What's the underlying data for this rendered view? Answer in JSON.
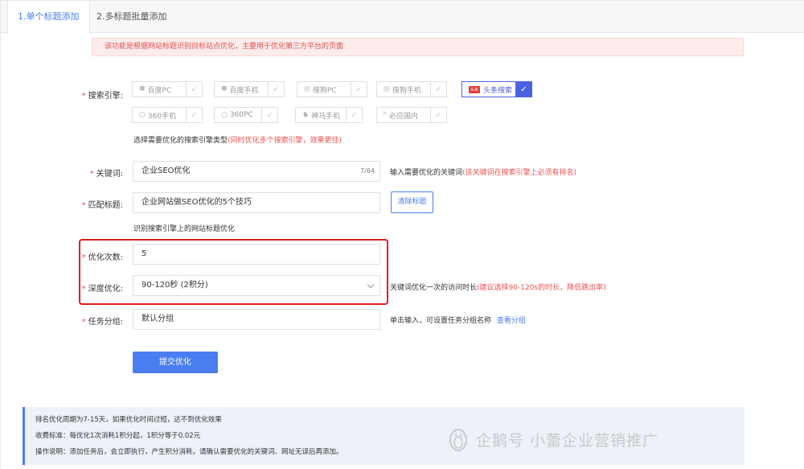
{
  "tabs": [
    {
      "label": "1.单个标题添加",
      "active": true
    },
    {
      "label": "2.多标题批量添加",
      "active": false
    }
  ],
  "notice": "该功能是根据网站标题识别目标站点优化，主要用于优化第三方平台的页面",
  "engines": {
    "label": "搜索引擎:",
    "row1": [
      {
        "name": "百度PC",
        "icon": "baidu-icon",
        "selected": false
      },
      {
        "name": "百度手机",
        "icon": "baidu-icon",
        "selected": false
      },
      {
        "name": "搜狗PC",
        "icon": "sogou-icon",
        "selected": false
      },
      {
        "name": "搜狗手机",
        "icon": "sogou-icon",
        "selected": false
      },
      {
        "name": "头条搜索",
        "icon": "toutiao-icon",
        "selected": true
      }
    ],
    "row2": [
      {
        "name": "360手机",
        "icon": "360-icon",
        "selected": false
      },
      {
        "name": "360PC",
        "icon": "360-icon",
        "selected": false
      },
      {
        "name": "神马手机",
        "icon": "shenma-icon",
        "selected": false
      },
      {
        "name": "必应国内",
        "icon": "bing-icon",
        "selected": false
      }
    ],
    "toutiao_badge": "头条",
    "hint": "选择需要优化的搜索引擎类型",
    "hint_red": "(同时优化多个搜索引擎，效果更佳)"
  },
  "keyword": {
    "label": "关键词:",
    "value": "企业SEO优化",
    "count": "7/64",
    "hint": "输入需要优化的关键词",
    "hint_red": "(该关键词在搜索引擎上必须有排名)"
  },
  "title": {
    "label": "匹配标题:",
    "value": "企业网站做SEO优化的5个技巧",
    "clear_button": "清除标题",
    "hint": "识别搜索引擎上的网站标题优化"
  },
  "times": {
    "label": "优化次数:",
    "value": "5"
  },
  "depth": {
    "label": "深度优化:",
    "value": "90-120秒 (2积分)",
    "hint": "关键词优化一次的访问时长",
    "hint_red": "(建议选择90-120s的时长，降低跳出率)"
  },
  "group": {
    "label": "任务分组:",
    "value": "默认分组",
    "hint": "单击输入，可设置任务分组名称",
    "link": "查看分组"
  },
  "submit": "提交优化",
  "info": [
    "排名优化周期为7-15天，如果优化时间过短，达不到优化效果",
    "收费标准：每优化1次消耗1积分起，1积分等于0.02元",
    "操作说明：添加任务后，会立即执行，产生积分消耗，请确认需要优化的关键词、网址无误后再添加。"
  ],
  "watermark": "企鹅号 小蕾企业营销推广",
  "colors": {
    "accent": "#4a7ef0",
    "selected": "#4a62e0",
    "warning": "#f05050",
    "highlight_box": "#e02020"
  }
}
